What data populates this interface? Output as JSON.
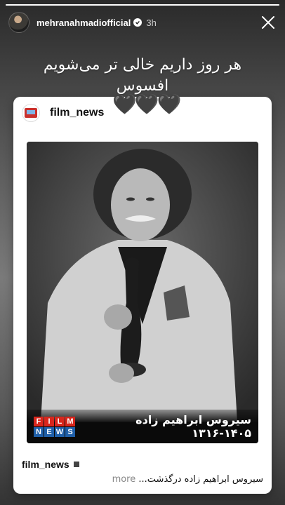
{
  "story": {
    "progress": 1.0,
    "username": "mehranahmadiofficial",
    "verified_icon": "verified-badge-icon",
    "time": "3h",
    "close_icon": "close-icon"
  },
  "caption": {
    "line1": "هر روز داریم خالی تر می‌شویم",
    "line2": "افسوس",
    "hearts": "🖤🖤🖤"
  },
  "post": {
    "username": "film_news",
    "banner_text": "سیروس ابراهیم زاده ۱۴۰۵-۱۳۱۶",
    "logo_letters": [
      "F",
      "I",
      "L",
      "M",
      "N",
      "E",
      "W",
      "S"
    ],
    "logo_colors": [
      "#d8261c",
      "#1f5fa8"
    ],
    "footer_username": "film_news",
    "footer_caption": "سیروس ابراهیم زاده درگذشت...",
    "more_label": "more"
  }
}
